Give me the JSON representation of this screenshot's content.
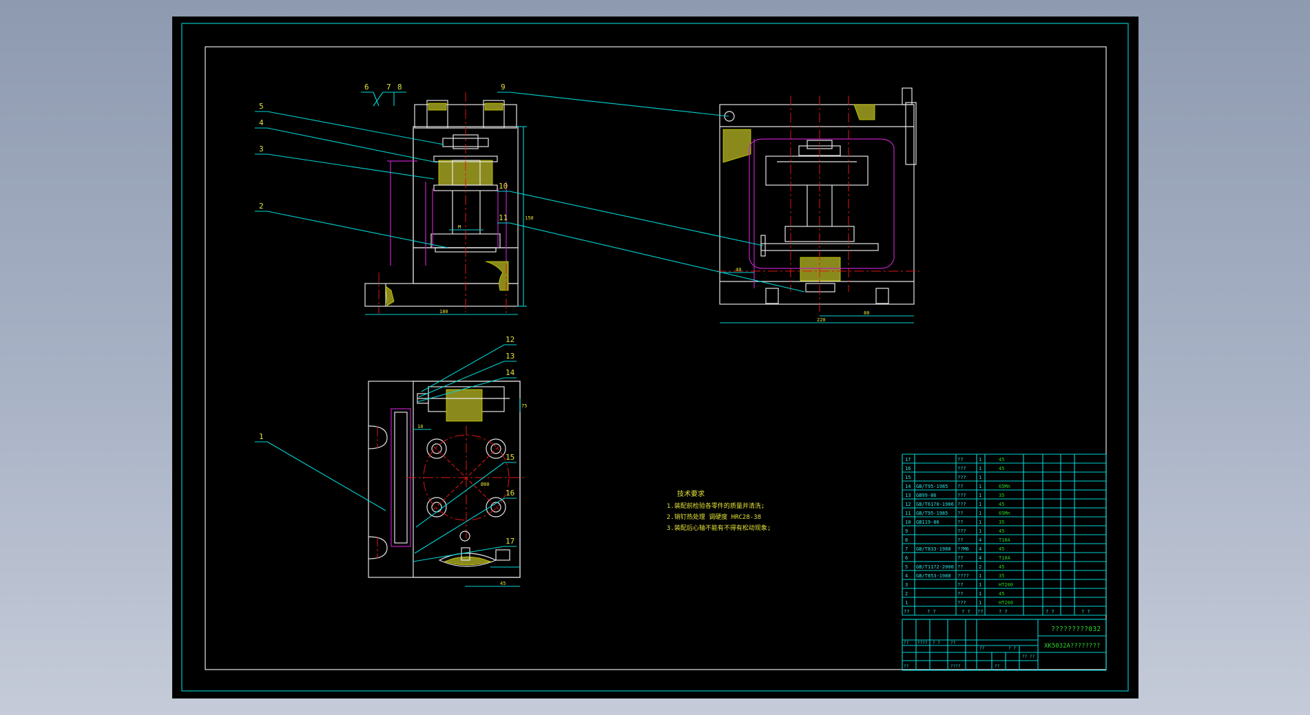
{
  "drawing": {
    "title_code": "?????????032",
    "title_name": "XK5032A????????",
    "tech_notes": {
      "heading": "技术要求",
      "lines": [
        "1.装配前检验各零件的质量并清洗;",
        "2.销钉热处理 调硬度 HRC28-38",
        "3.装配后心轴不能有不得有松动现象;"
      ]
    },
    "balloons": [
      "1",
      "2",
      "3",
      "4",
      "5",
      "6",
      "7",
      "8",
      "9",
      "10",
      "11",
      "12",
      "13",
      "14",
      "15",
      "16",
      "17"
    ],
    "dimensions": {
      "front_width": "180",
      "front_height": "150",
      "side_width": "220",
      "side_half": "80",
      "side_left": "40",
      "top_ref": "75",
      "top_small": "10",
      "top_bottom": "45",
      "circle_dia": "Ø80",
      "dim_m": "M",
      "dim_width2": "45"
    },
    "bom": {
      "rows": [
        {
          "no": "17",
          "std": "",
          "name": "??",
          "qty": "1",
          "mat": "45"
        },
        {
          "no": "16",
          "std": "",
          "name": "???",
          "qty": "1",
          "mat": "45"
        },
        {
          "no": "15",
          "std": "",
          "name": "???",
          "qty": "1",
          "mat": ""
        },
        {
          "no": "14",
          "std": "GB/T95-1985",
          "name": "??",
          "qty": "1",
          "mat": "65Mn"
        },
        {
          "no": "13",
          "std": "GB99-86",
          "name": "???",
          "qty": "1",
          "mat": "35"
        },
        {
          "no": "12",
          "std": "GB/T6170-1986",
          "name": "???",
          "qty": "1",
          "mat": "45"
        },
        {
          "no": "11",
          "std": "GB/T95-1985",
          "name": "??",
          "qty": "1",
          "mat": "65Mn"
        },
        {
          "no": "10",
          "std": "GB119-86",
          "name": "??",
          "qty": "1",
          "mat": "35"
        },
        {
          "no": "9",
          "std": "",
          "name": "???",
          "qty": "1",
          "mat": "45"
        },
        {
          "no": "8",
          "std": "",
          "name": "??",
          "qty": "4",
          "mat": "T10A"
        },
        {
          "no": "7",
          "std": "GB/T833-1988",
          "name": "??M6",
          "qty": "4",
          "mat": "45"
        },
        {
          "no": "6",
          "std": "",
          "name": "??",
          "qty": "4",
          "mat": "T10A"
        },
        {
          "no": "5",
          "std": "GB/T1172-2000",
          "name": "??",
          "qty": "2",
          "mat": "45"
        },
        {
          "no": "4",
          "std": "GB/T853-1988",
          "name": "????",
          "qty": "1",
          "mat": "35"
        },
        {
          "no": "3",
          "std": "",
          "name": "??",
          "qty": "1",
          "mat": "HT200"
        },
        {
          "no": "2",
          "std": "",
          "name": "??",
          "qty": "1",
          "mat": "45"
        },
        {
          "no": "1",
          "std": "",
          "name": "???",
          "qty": "1",
          "mat": "HT200"
        }
      ],
      "header": {
        "no": "??",
        "std": "? ?",
        "name": "? ?",
        "qty": "??",
        "mat": "? ?",
        "weight": "? ?",
        "note": "? ?"
      },
      "misc": [
        "??",
        "????",
        "? ?",
        "??",
        "??",
        "??",
        "????",
        "??",
        "?? ??",
        "? ?"
      ]
    }
  },
  "colors": {
    "sheet": "#000000",
    "border": "#00d6d6",
    "outline": "#e6e6e6",
    "hidden": "#c021c6",
    "center": "#e01616",
    "section": "#d6d600",
    "text": "#e3e33a"
  }
}
